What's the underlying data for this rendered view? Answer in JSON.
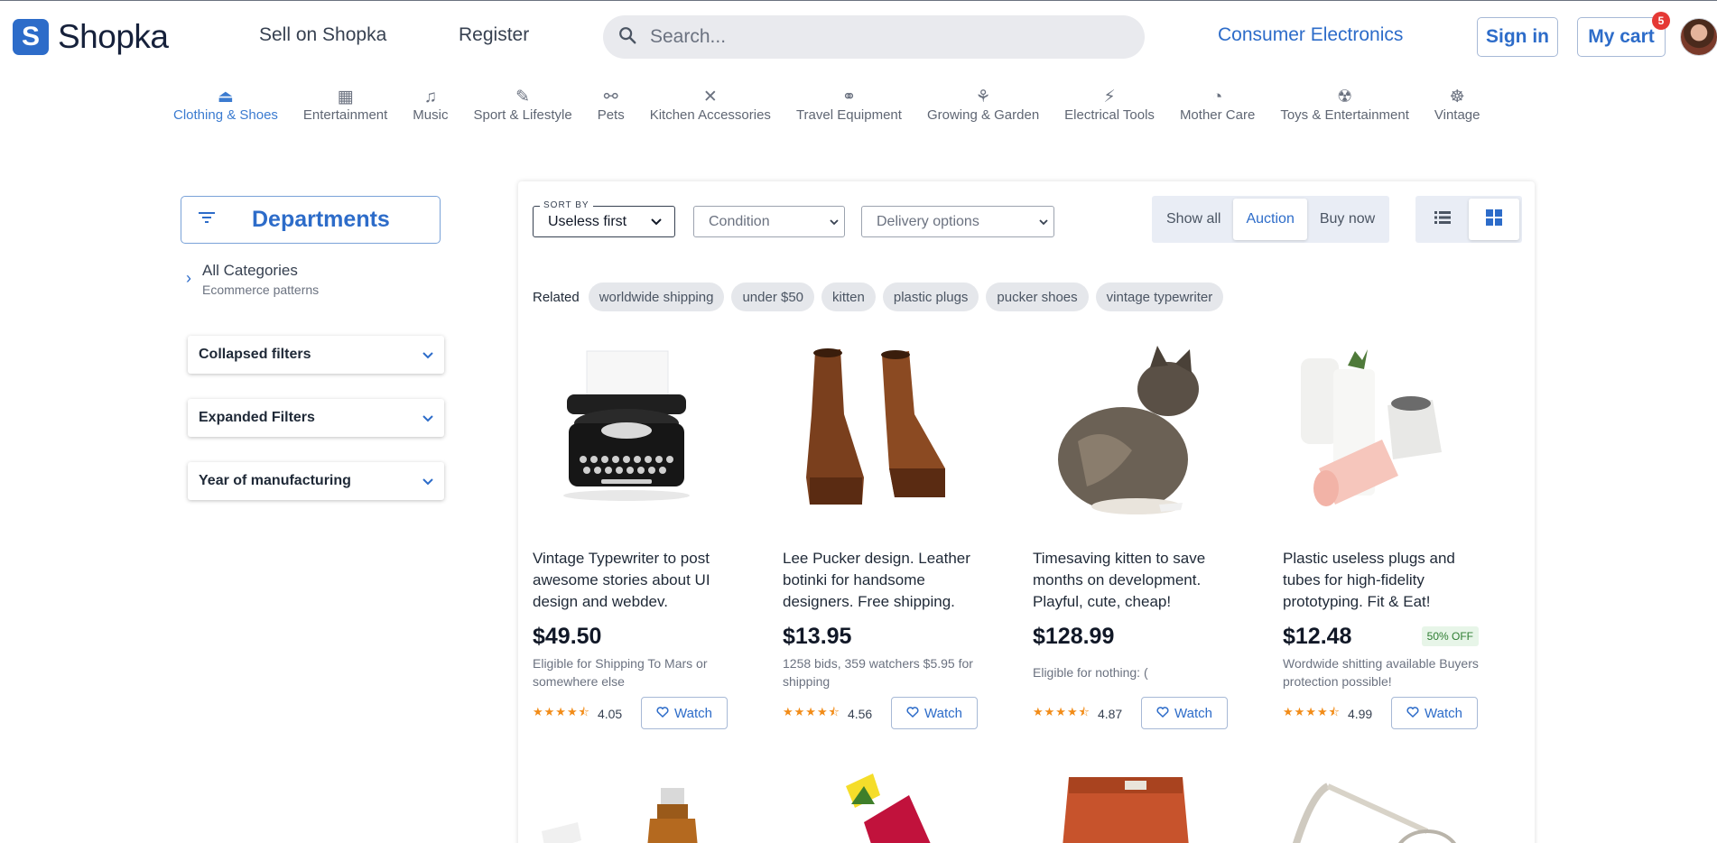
{
  "header": {
    "logo_letter": "S",
    "logo_text": "Shopka",
    "nav": [
      "Sell on Shopka",
      "Register"
    ],
    "search_placeholder": "Search...",
    "consumer_link": "Consumer Electronics",
    "signin": "Sign in",
    "cart": "My cart",
    "cart_count": "5"
  },
  "categories": [
    {
      "label": "Clothing & Shoes",
      "icon": "hanger-icon",
      "active": true
    },
    {
      "label": "Entertainment",
      "icon": "film-icon"
    },
    {
      "label": "Music",
      "icon": "music-note-icon"
    },
    {
      "label": "Sport & Lifestyle",
      "icon": "dumbbell-icon"
    },
    {
      "label": "Pets",
      "icon": "bone-icon"
    },
    {
      "label": "Kitchen Accessories",
      "icon": "utensils-icon"
    },
    {
      "label": "Travel Equipment",
      "icon": "binoculars-icon"
    },
    {
      "label": "Growing & Garden",
      "icon": "wheat-icon"
    },
    {
      "label": "Electrical Tools",
      "icon": "plug-icon"
    },
    {
      "label": "Mother Care",
      "icon": "stroller-icon"
    },
    {
      "label": "Toys & Entertainment",
      "icon": "radiation-icon"
    },
    {
      "label": "Vintage",
      "icon": "ship-wheel-icon"
    }
  ],
  "sidebar": {
    "departments": "Departments",
    "all_categories": "All Categories",
    "all_categories_sub": "Ecommerce patterns",
    "filters": [
      "Collapsed filters",
      "Expanded Filters",
      "Year of manufacturing"
    ]
  },
  "toolbar": {
    "sort_label": "SORT BY",
    "sort_value": "Useless first",
    "condition": "Condition",
    "delivery": "Delivery options",
    "segments": [
      "Show all",
      "Auction",
      "Buy now"
    ],
    "active_segment": "Auction",
    "view_active": "grid"
  },
  "related": {
    "label": "Related",
    "chips": [
      "worldwide shipping",
      "under $50",
      "kitten",
      "plastic plugs",
      "pucker shoes",
      "vintage typewriter"
    ]
  },
  "products": [
    {
      "title": "Vintage Typewriter to post awesome stories about UI design and webdev.",
      "price": "$49.50",
      "info": "Eligible for Shipping To Mars or somewhere else",
      "rating": "4.05",
      "badge": "",
      "watch": "Watch"
    },
    {
      "title": "Lee Pucker design. Leather botinki for handsome designers. Free shipping.",
      "price": "$13.95",
      "info": "1258 bids, 359 watchers $5.95 for shipping",
      "rating": "4.56",
      "badge": "",
      "watch": "Watch"
    },
    {
      "title": "Timesaving kitten to save months on development. Playful, cute, cheap!",
      "price": "$128.99",
      "info": "Eligible for nothing: (",
      "rating": "4.87",
      "badge": "",
      "watch": "Watch"
    },
    {
      "title": "Plastic useless plugs and tubes for high-fidelity prototyping. Fit & Eat!",
      "price": "$12.48",
      "info": "Wordwide shitting available Buyers protection possible!",
      "rating": "4.99",
      "badge": "50% OFF",
      "watch": "Watch"
    }
  ],
  "colors": {
    "accent": "#2d6cc9",
    "star": "#f28c18",
    "badge_bg": "#e7f5e8",
    "badge_text": "#2e7d32"
  }
}
